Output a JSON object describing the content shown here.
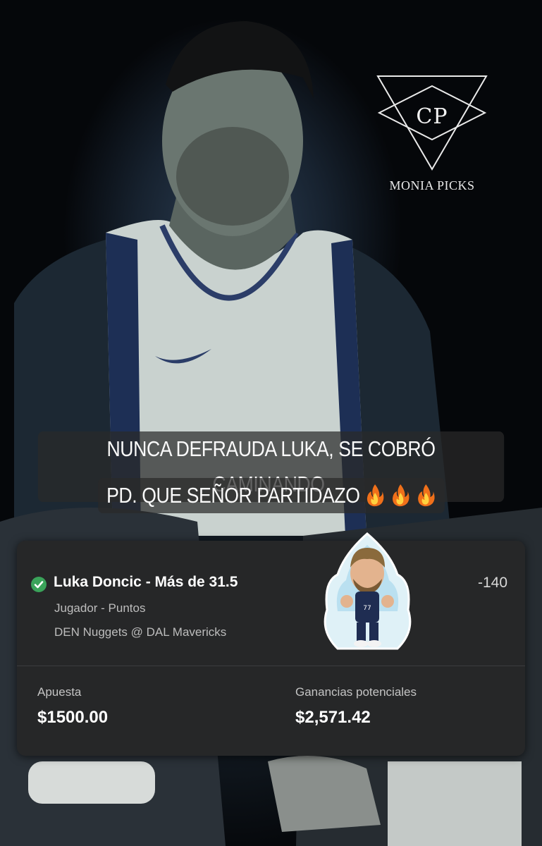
{
  "branding": {
    "monogram": "CP",
    "name": "MONIA PICKS"
  },
  "caption": {
    "line1": "NUNCA DEFRAUDA LUKA, SE COBRÓ CAMINANDO,",
    "line2": "PD. QUE SEÑOR PARTIDAZO",
    "emoji": [
      "fire-icon",
      "fire-icon",
      "fire-icon"
    ]
  },
  "bet_slip": {
    "status_icon": "check-circle-icon",
    "selection": "Luka Doncic - Más de 31.5",
    "odds": "-140",
    "market": "Jugador - Puntos",
    "game": "DEN Nuggets @ DAL Mavericks",
    "stake_label": "Apuesta",
    "stake_value": "$1500.00",
    "payout_label": "Ganancias potenciales",
    "payout_value": "$2,571.42",
    "sticker": "cartoon-player-sticker"
  },
  "colors": {
    "check": "#3aa35a",
    "card": "#262728",
    "fire_outer": "#f0701a",
    "fire_inner": "#ffd23f"
  }
}
